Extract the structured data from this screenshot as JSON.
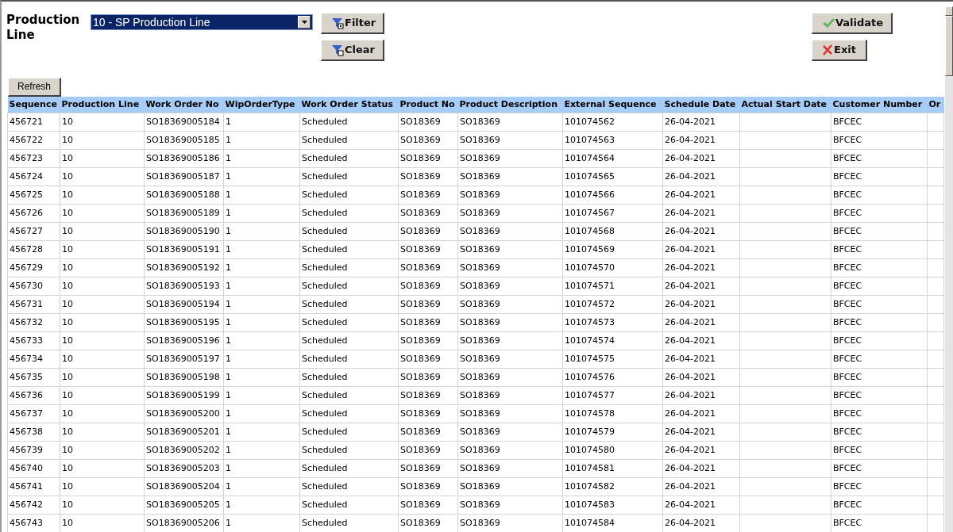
{
  "filter": {
    "label": "Production Line",
    "selected_line": "10 - SP Production Line"
  },
  "buttons": {
    "filter": "Filter",
    "clear": "Clear",
    "validate": "Validate",
    "exit": "Exit",
    "refresh": "Refresh"
  },
  "table": {
    "columns": [
      "Sequence",
      "Production Line",
      "Work Order No",
      "WipOrderType",
      "Work Order Status",
      "Product No",
      "Product Description",
      "External Sequence",
      "Schedule Date",
      "Actual Start Date",
      "Customer Number",
      "Or"
    ],
    "rows": [
      [
        "456721",
        "10",
        "SO18369005184",
        "1",
        "Scheduled",
        "SO18369",
        "SO18369",
        "101074562",
        "26-04-2021",
        null,
        "BFCEC",
        null
      ],
      [
        "456722",
        "10",
        "SO18369005185",
        "1",
        "Scheduled",
        "SO18369",
        "SO18369",
        "101074563",
        "26-04-2021",
        null,
        "BFCEC",
        null
      ],
      [
        "456723",
        "10",
        "SO18369005186",
        "1",
        "Scheduled",
        "SO18369",
        "SO18369",
        "101074564",
        "26-04-2021",
        null,
        "BFCEC",
        null
      ],
      [
        "456724",
        "10",
        "SO18369005187",
        "1",
        "Scheduled",
        "SO18369",
        "SO18369",
        "101074565",
        "26-04-2021",
        null,
        "BFCEC",
        null
      ],
      [
        "456725",
        "10",
        "SO18369005188",
        "1",
        "Scheduled",
        "SO18369",
        "SO18369",
        "101074566",
        "26-04-2021",
        null,
        "BFCEC",
        null
      ],
      [
        "456726",
        "10",
        "SO18369005189",
        "1",
        "Scheduled",
        "SO18369",
        "SO18369",
        "101074567",
        "26-04-2021",
        null,
        "BFCEC",
        null
      ],
      [
        "456727",
        "10",
        "SO18369005190",
        "1",
        "Scheduled",
        "SO18369",
        "SO18369",
        "101074568",
        "26-04-2021",
        null,
        "BFCEC",
        null
      ],
      [
        "456728",
        "10",
        "SO18369005191",
        "1",
        "Scheduled",
        "SO18369",
        "SO18369",
        "101074569",
        "26-04-2021",
        null,
        "BFCEC",
        null
      ],
      [
        "456729",
        "10",
        "SO18369005192",
        "1",
        "Scheduled",
        "SO18369",
        "SO18369",
        "101074570",
        "26-04-2021",
        null,
        "BFCEC",
        null
      ],
      [
        "456730",
        "10",
        "SO18369005193",
        "1",
        "Scheduled",
        "SO18369",
        "SO18369",
        "101074571",
        "26-04-2021",
        null,
        "BFCEC",
        null
      ],
      [
        "456731",
        "10",
        "SO18369005194",
        "1",
        "Scheduled",
        "SO18369",
        "SO18369",
        "101074572",
        "26-04-2021",
        null,
        "BFCEC",
        null
      ],
      [
        "456732",
        "10",
        "SO18369005195",
        "1",
        "Scheduled",
        "SO18369",
        "SO18369",
        "101074573",
        "26-04-2021",
        null,
        "BFCEC",
        null
      ],
      [
        "456733",
        "10",
        "SO18369005196",
        "1",
        "Scheduled",
        "SO18369",
        "SO18369",
        "101074574",
        "26-04-2021",
        null,
        "BFCEC",
        null
      ],
      [
        "456734",
        "10",
        "SO18369005197",
        "1",
        "Scheduled",
        "SO18369",
        "SO18369",
        "101074575",
        "26-04-2021",
        null,
        "BFCEC",
        null
      ],
      [
        "456735",
        "10",
        "SO18369005198",
        "1",
        "Scheduled",
        "SO18369",
        "SO18369",
        "101074576",
        "26-04-2021",
        null,
        "BFCEC",
        null
      ],
      [
        "456736",
        "10",
        "SO18369005199",
        "1",
        "Scheduled",
        "SO18369",
        "SO18369",
        "101074577",
        "26-04-2021",
        null,
        "BFCEC",
        null
      ],
      [
        "456737",
        "10",
        "SO18369005200",
        "1",
        "Scheduled",
        "SO18369",
        "SO18369",
        "101074578",
        "26-04-2021",
        null,
        "BFCEC",
        null
      ],
      [
        "456738",
        "10",
        "SO18369005201",
        "1",
        "Scheduled",
        "SO18369",
        "SO18369",
        "101074579",
        "26-04-2021",
        null,
        "BFCEC",
        null
      ],
      [
        "456739",
        "10",
        "SO18369005202",
        "1",
        "Scheduled",
        "SO18369",
        "SO18369",
        "101074580",
        "26-04-2021",
        null,
        "BFCEC",
        null
      ],
      [
        "456740",
        "10",
        "SO18369005203",
        "1",
        "Scheduled",
        "SO18369",
        "SO18369",
        "101074581",
        "26-04-2021",
        null,
        "BFCEC",
        null
      ],
      [
        "456741",
        "10",
        "SO18369005204",
        "1",
        "Scheduled",
        "SO18369",
        "SO18369",
        "101074582",
        "26-04-2021",
        null,
        "BFCEC",
        null
      ],
      [
        "456742",
        "10",
        "SO18369005205",
        "1",
        "Scheduled",
        "SO18369",
        "SO18369",
        "101074583",
        "26-04-2021",
        null,
        "BFCEC",
        null
      ],
      [
        "456743",
        "10",
        "SO18369005206",
        "1",
        "Scheduled",
        "SO18369",
        "SO18369",
        "101074584",
        "26-04-2021",
        null,
        "BFCEC",
        null
      ]
    ]
  }
}
